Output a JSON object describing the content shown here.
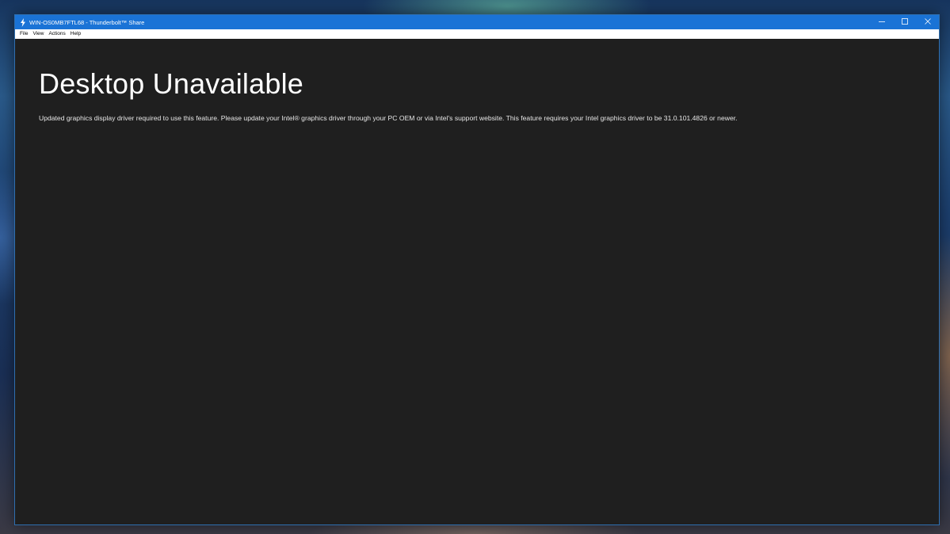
{
  "window": {
    "title": "WIN-OS0MB7FTL68 - Thunderbolt™ Share",
    "controls": {
      "minimize_icon": "minimize-icon",
      "maximize_icon": "maximize-icon",
      "close_icon": "close-icon"
    },
    "app_icon": "thunderbolt-icon"
  },
  "menu": {
    "items": [
      {
        "label": "File"
      },
      {
        "label": "View"
      },
      {
        "label": "Actions"
      },
      {
        "label": "Help"
      }
    ]
  },
  "main": {
    "heading": "Desktop Unavailable",
    "message": "Updated graphics display driver required to use this feature.  Please update your Intel® graphics driver through your PC OEM or via Intel's support website.  This feature requires your Intel graphics driver to be 31.0.101.4826 or newer."
  },
  "colors": {
    "titlebar": "#1a73d6",
    "content_background": "#1f1f1f",
    "heading_text": "#ffffff"
  }
}
